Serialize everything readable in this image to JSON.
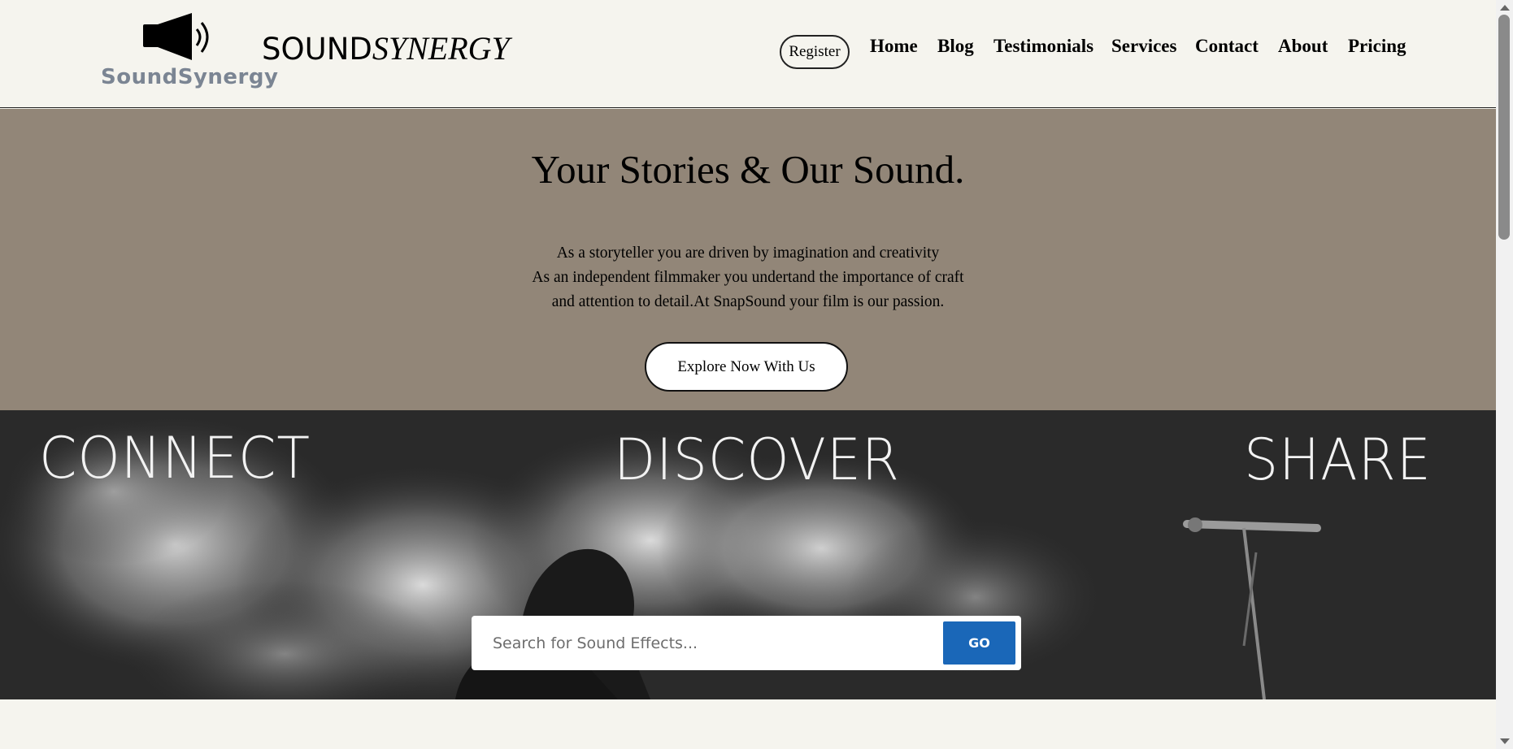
{
  "header": {
    "logo_text": "SoundSynergy",
    "brand_part1": "SOUND",
    "brand_part2": "SYNERGY",
    "register_label": "Register",
    "nav": [
      "Home",
      "Blog",
      "Testimonials",
      "Services",
      "Contact",
      "About",
      "Pricing"
    ]
  },
  "hero": {
    "title": "Your Stories & Our Sound.",
    "lines": [
      "As a storyteller you are driven by imagination and creativity",
      "As an independent filmmaker you undertand the importance of craft",
      "and attention to detail.At SnapSound your film is our passion."
    ],
    "cta_label": "Explore Now With Us"
  },
  "banner": {
    "words": [
      "CONNECT",
      "DISCOVER",
      "SHARE"
    ],
    "search": {
      "placeholder": "Search for Sound Effects...",
      "button_label": "GO"
    }
  },
  "colors": {
    "page_bg": "#f5f4ee",
    "hero_bg": "#928678",
    "banner_bg": "#2b2b2b",
    "go_button": "#1a67b8"
  },
  "icons": [
    "speaker-icon",
    "chevron-up-icon",
    "chevron-down-icon"
  ]
}
